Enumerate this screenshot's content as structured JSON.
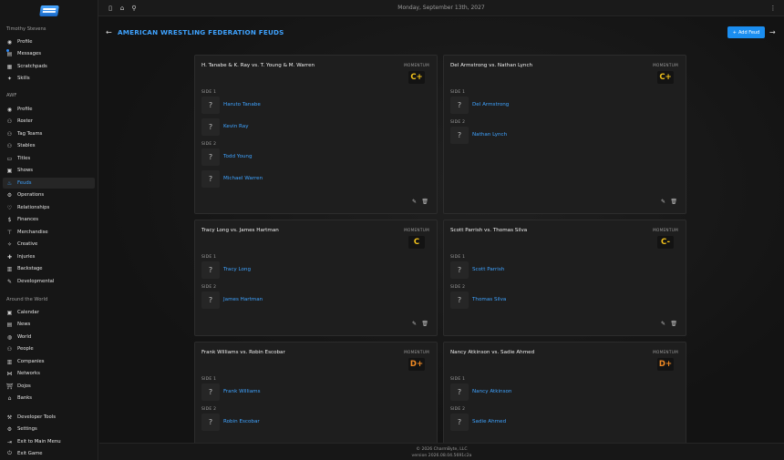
{
  "topbar": {
    "date": "Monday, September 13th, 2027"
  },
  "sidebar": {
    "user_section": "Timothy Stevens",
    "user_items": [
      {
        "label": "Profile",
        "icon": "person-circle-icon"
      },
      {
        "label": "Messages",
        "icon": "chat-icon"
      },
      {
        "label": "Scratchpads",
        "icon": "notepad-icon"
      },
      {
        "label": "Skills",
        "icon": "star-icon"
      }
    ],
    "company_section": "AWF",
    "company_items": [
      {
        "label": "Profile",
        "icon": "person-circle-icon"
      },
      {
        "label": "Roster",
        "icon": "people-icon"
      },
      {
        "label": "Tag Teams",
        "icon": "people-icon"
      },
      {
        "label": "Stables",
        "icon": "people-icon"
      },
      {
        "label": "Titles",
        "icon": "belt-icon"
      },
      {
        "label": "Shows",
        "icon": "calendar-icon"
      },
      {
        "label": "Feuds",
        "icon": "fire-icon"
      },
      {
        "label": "Operations",
        "icon": "gear-icon"
      },
      {
        "label": "Relationships",
        "icon": "heart-icon"
      },
      {
        "label": "Finances",
        "icon": "dollar-icon"
      },
      {
        "label": "Merchandise",
        "icon": "shirt-icon"
      },
      {
        "label": "Creative",
        "icon": "lightbulb-icon"
      },
      {
        "label": "Injuries",
        "icon": "bandage-icon"
      },
      {
        "label": "Backstage",
        "icon": "clipboard-icon"
      },
      {
        "label": "Developmental",
        "icon": "pencil-icon"
      }
    ],
    "world_section": "Around the World",
    "world_items": [
      {
        "label": "Calendar",
        "icon": "calendar-icon"
      },
      {
        "label": "News",
        "icon": "newspaper-icon"
      },
      {
        "label": "World",
        "icon": "globe-icon"
      },
      {
        "label": "People",
        "icon": "people-icon"
      },
      {
        "label": "Companies",
        "icon": "building-icon"
      },
      {
        "label": "Networks",
        "icon": "network-icon"
      },
      {
        "label": "Dojos",
        "icon": "dojo-icon"
      },
      {
        "label": "Banks",
        "icon": "bank-icon"
      }
    ],
    "bottom_items": [
      {
        "label": "Developer Tools",
        "icon": "wrench-icon"
      },
      {
        "label": "Settings",
        "icon": "gear-icon"
      },
      {
        "label": "Exit to Main Menu",
        "icon": "exit-icon"
      },
      {
        "label": "Exit Game",
        "icon": "power-icon"
      }
    ]
  },
  "main": {
    "title": "AMERICAN WRESTLING FEDERATION FEUDS",
    "add_label": "Add Feud",
    "momentum_label": "MOMENTUM",
    "side1_label": "SIDE 1",
    "side2_label": "SIDE 2",
    "avatar_placeholder": "?",
    "feuds": [
      {
        "title": "H. Tanabe & K. Ray vs. T. Young & M. Warren",
        "grade": "C+",
        "side1": [
          "Haruto Tanabe",
          "Kevin Ray"
        ],
        "side2": [
          "Todd Young",
          "Michael Warren"
        ]
      },
      {
        "title": "Del Armstrong vs. Nathan Lynch",
        "grade": "C+",
        "side1": [
          "Del Armstrong"
        ],
        "side2": [
          "Nathan Lynch"
        ]
      },
      {
        "title": "Tracy Long vs. James Hartman",
        "grade": "C",
        "side1": [
          "Tracy Long"
        ],
        "side2": [
          "James Hartman"
        ]
      },
      {
        "title": "Scott Parrish vs. Thomas Silva",
        "grade": "C-",
        "side1": [
          "Scott Parrish"
        ],
        "side2": [
          "Thomas Silva"
        ]
      },
      {
        "title": "Frank Williams vs. Robin Escobar",
        "grade": "D+",
        "side1": [
          "Frank Williams"
        ],
        "side2": [
          "Robin Escobar"
        ]
      },
      {
        "title": "Nancy Atkinson vs. Sadie Ahmed",
        "grade": "D+",
        "side1": [
          "Nancy Atkinson"
        ],
        "side2": [
          "Sadie Ahmed"
        ]
      }
    ]
  },
  "colors": {
    "accent": "#3fa3ff",
    "button": "#1b8ef0",
    "grade_c": "#f2c21b",
    "grade_d": "#f08a24"
  },
  "footer": {
    "copyright": "© 2026 CharmByte, LLC",
    "version": "version 2026.08.04.5691c2a"
  }
}
